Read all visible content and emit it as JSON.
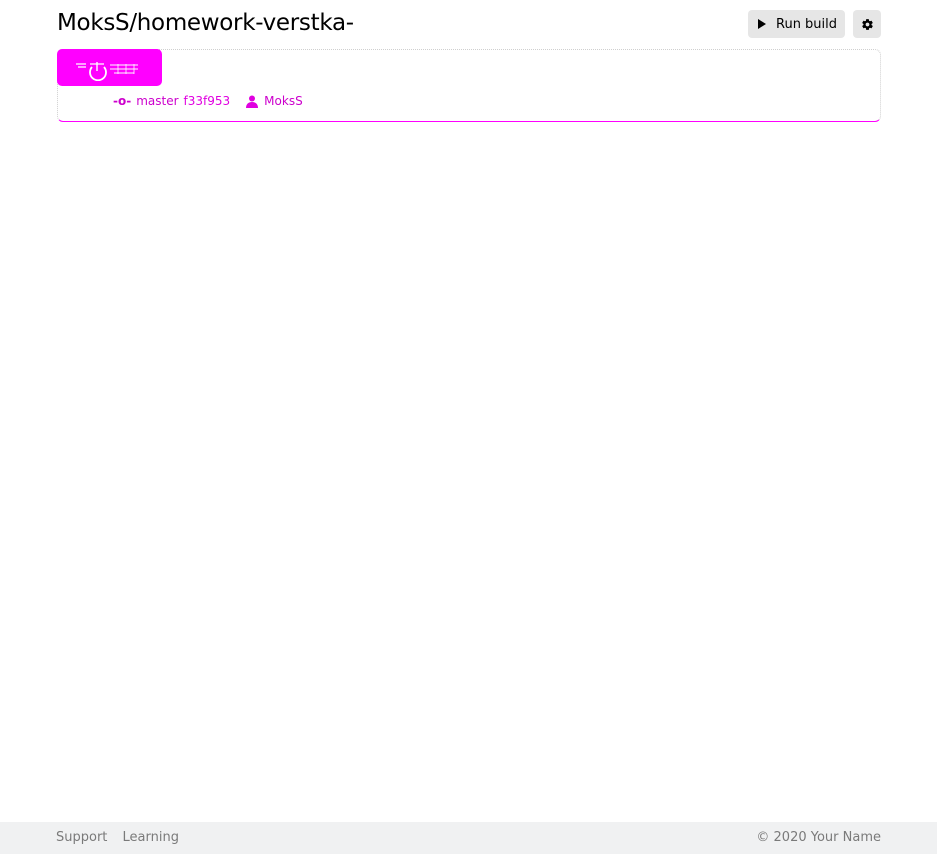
{
  "header": {
    "title": "MoksS/homework-verstka-",
    "run_build_label": "Run build"
  },
  "build": {
    "branch_icon": "-o-",
    "branch": "master",
    "commit_hash": "f33f953",
    "author": "MoksS",
    "badge_color": "#ff00ff"
  },
  "footer": {
    "links": [
      "Support",
      "Learning"
    ],
    "copyright": "© 2020 Your Name"
  },
  "colors": {
    "accent": "#ff00ff",
    "button_bg": "#e6e6e6",
    "footer_bg": "#f0f1f2"
  }
}
